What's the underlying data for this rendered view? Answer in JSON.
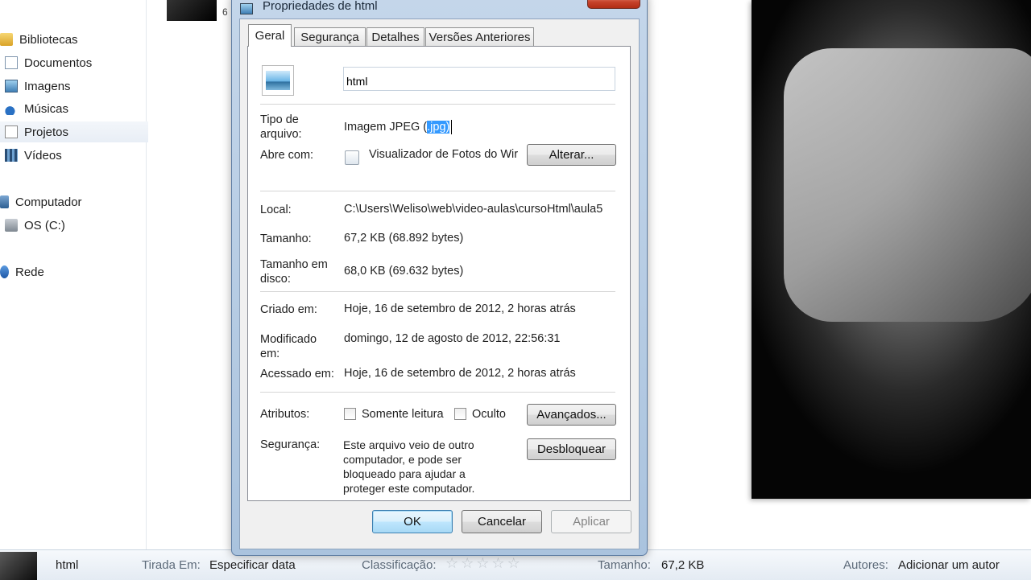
{
  "nav": {
    "items": [
      {
        "label": "Bibliotecas",
        "icon": "library-icon"
      },
      {
        "label": "Documentos",
        "icon": "documents-icon"
      },
      {
        "label": "Imagens",
        "icon": "pictures-icon"
      },
      {
        "label": "Músicas",
        "icon": "music-icon"
      },
      {
        "label": "Projetos",
        "icon": "projects-icon"
      },
      {
        "label": "Vídeos",
        "icon": "videos-icon"
      },
      {
        "label": "Computador",
        "icon": "computer-icon"
      },
      {
        "label": "OS (C:)",
        "icon": "drive-icon"
      },
      {
        "label": "Rede",
        "icon": "network-icon"
      }
    ]
  },
  "thumb_caption": "6",
  "dialog": {
    "title": "Propriedades de html",
    "tabs": [
      "Geral",
      "Segurança",
      "Detalhes",
      "Versões Anteriores"
    ],
    "active_tab": "Geral",
    "file_name": "html",
    "type_label": "Tipo de arquivo:",
    "type_value_prefix": "Imagem JPEG (",
    "type_value_selected": ".jpg)",
    "opens_label": "Abre com:",
    "opens_value": "Visualizador de Fotos do Wir",
    "change_button": "Alterar...",
    "location_label": "Local:",
    "location_value": "C:\\Users\\Weliso\\web\\video-aulas\\cursoHtml\\aula5",
    "size_label": "Tamanho:",
    "size_value": "67,2 KB (68.892 bytes)",
    "size_disk_label": "Tamanho em disco:",
    "size_disk_value": "68,0 KB (69.632 bytes)",
    "created_label": "Criado em:",
    "created_value": "Hoje, 16 de setembro de 2012, 2 horas atrás",
    "modified_label": "Modificado em:",
    "modified_value": "domingo, 12 de agosto de 2012, 22:56:31",
    "accessed_label": "Acessado em:",
    "accessed_value": "Hoje, 16 de setembro de 2012, 2 horas atrás",
    "attributes_label": "Atributos:",
    "readonly_label": "Somente leitura",
    "hidden_label": "Oculto",
    "advanced_button": "Avançados...",
    "security_label": "Segurança:",
    "security_text": "Este arquivo veio de outro computador, e pode ser bloqueado para ajudar a proteger este computador.",
    "unblock_button": "Desbloquear",
    "ok_button": "OK",
    "cancel_button": "Cancelar",
    "apply_button": "Aplicar"
  },
  "details": {
    "name": "html",
    "taken_label": "Tirada Em:",
    "taken_value": "Especificar data",
    "rating_label": "Classificação:",
    "size_label": "Tamanho:",
    "size_value": "67,2 KB",
    "authors_label": "Autores:",
    "authors_value": "Adicionar um autor"
  },
  "colors": {
    "selection": "#3399ff",
    "dialog_frame": "#aac3de",
    "close_button": "#c7432b"
  }
}
